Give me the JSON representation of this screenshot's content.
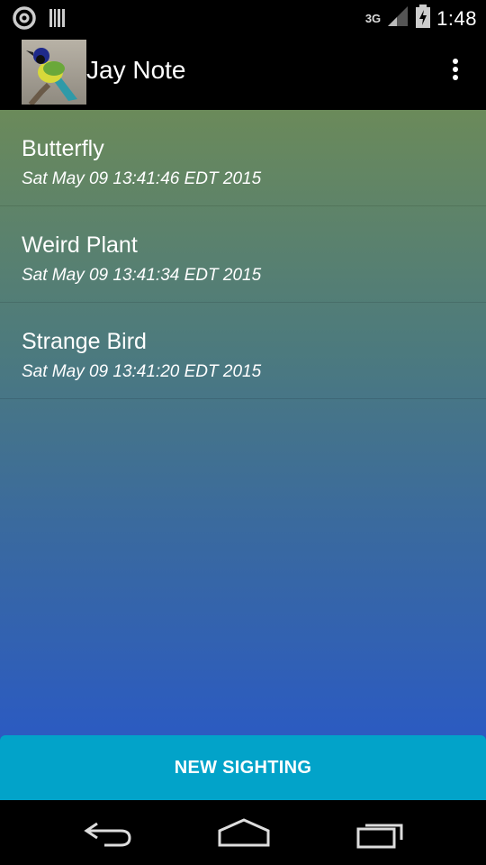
{
  "status_bar": {
    "time": "1:48",
    "network": "3G",
    "icons": [
      "notification-ring-icon",
      "barcode-icon",
      "signal-icon",
      "battery-charging-icon"
    ]
  },
  "action_bar": {
    "title": "Jay Note",
    "logo": "green-jay-bird-photo",
    "overflow_icon": "overflow-menu-icon"
  },
  "sightings": [
    {
      "title": "Butterfly",
      "date": "Sat May 09 13:41:46 EDT 2015"
    },
    {
      "title": "Weird Plant",
      "date": "Sat May 09 13:41:34 EDT 2015"
    },
    {
      "title": "Strange Bird",
      "date": "Sat May 09 13:41:20 EDT 2015"
    }
  ],
  "new_button_label": "NEW SIGHTING",
  "nav_bar": {
    "icons": [
      "back-icon",
      "home-icon",
      "recent-apps-icon"
    ]
  },
  "colors": {
    "button": "#02a3c9",
    "gradient_top": "#6b8a5a",
    "gradient_bottom": "#2756cc"
  }
}
